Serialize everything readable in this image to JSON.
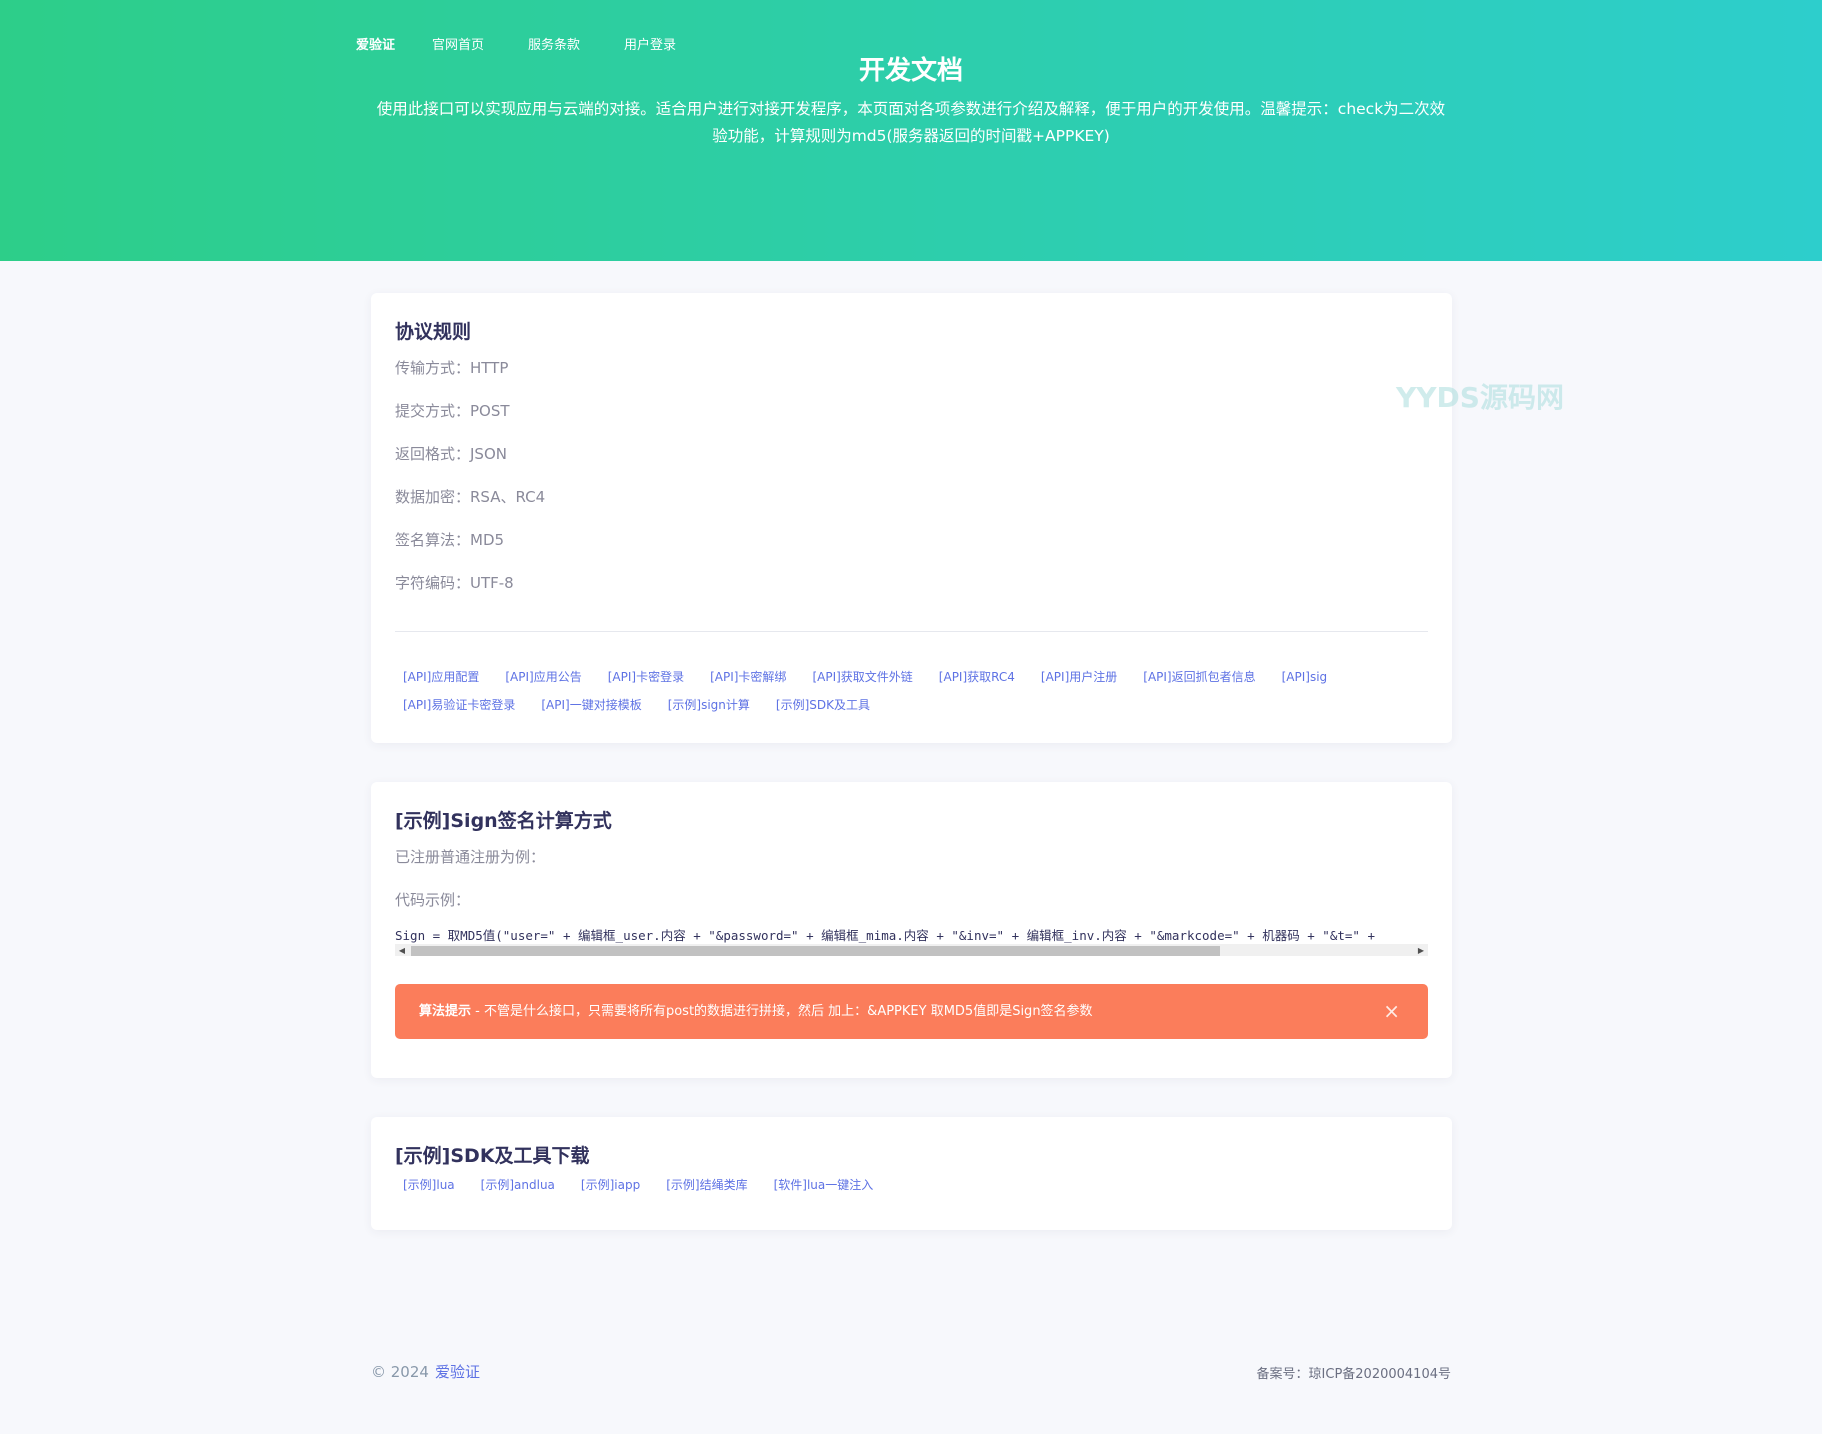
{
  "nav": {
    "brand": "爱验证",
    "items": [
      "官网首页",
      "服务条款",
      "用户登录"
    ]
  },
  "hero": {
    "title": "开发文档",
    "desc_line1": "使用此接口可以实现应用与云端的对接。适合用户进行对接开发程序，本页面对各项参数进行介绍及解释，便于用户的开发使用。温馨提示：check为二次效",
    "desc_line2": "验功能，计算规则为md5(服务器返回的时间戳+APPKEY)"
  },
  "watermark": "YYDS源码网",
  "protocol": {
    "title": "协议规则",
    "props": [
      "传输方式：HTTP",
      "提交方式：POST",
      "返回格式：JSON",
      "数据加密：RSA、RC4",
      "签名算法：MD5",
      "字符编码：UTF-8"
    ],
    "links_row1": [
      "[API]应用配置",
      "[API]应用公告",
      "[API]卡密登录",
      "[API]卡密解绑",
      "[API]获取文件外链",
      "[API]获取RC4",
      "[API]用户注册",
      "[API]返回抓包者信息",
      "[API]sig"
    ],
    "links_row2": [
      "[API]易验证卡密登录",
      "[API]一键对接模板",
      "[示例]sign计算",
      "[示例]SDK及工具"
    ]
  },
  "sign": {
    "title": "[示例]Sign签名计算方式",
    "line1": "已注册普通注册为例：",
    "line2": "代码示例：",
    "code": "Sign = 取MD5值(\"user=\" + 编辑框_user.内容 + \"&password=\" + 编辑框_mima.内容 + \"&inv=\" + 编辑框_inv.内容 + \"&markcode=\" + 机器码 + \"&t=\" + ",
    "alert_bold": "算法提示",
    "alert_text": " - 不管是什么接口，只需要将所有post的数据进行拼接，然后 加上：&APPKEY 取MD5值即是Sign签名参数",
    "alert_close": "×"
  },
  "sdk": {
    "title": "[示例]SDK及工具下载",
    "links": [
      "[示例]lua",
      "[示例]andlua",
      "[示例]iapp",
      "[示例]结绳类库",
      "[软件]lua一键注入"
    ]
  },
  "footer": {
    "copyright": "© 2024",
    "brand": "爱验证",
    "icp": "备案号：琼ICP备2020004104号"
  }
}
